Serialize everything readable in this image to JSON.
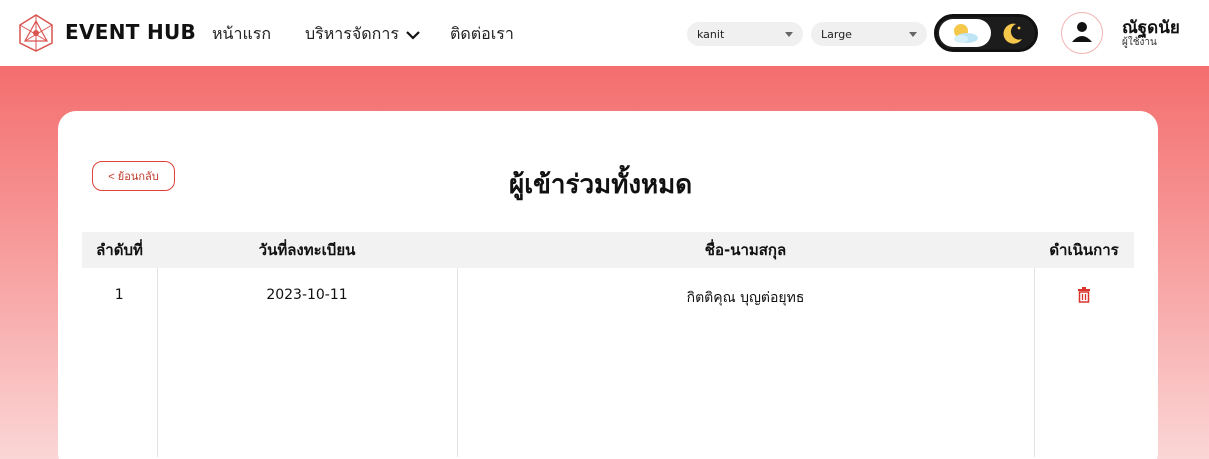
{
  "header": {
    "brand": "EVENT HUB",
    "nav": {
      "home": "หน้าแรก",
      "manage": "บริหารจัดการ",
      "contact": "ติดต่อเรา"
    },
    "font_select": {
      "value": "kanit"
    },
    "size_select": {
      "value": "Large"
    },
    "theme_toggle": {
      "light_icon": "sun-cloud-icon",
      "dark_icon": "moon-icon"
    },
    "user": {
      "name": "ณัฐดนัย",
      "role": "ผู้ใช้งาน"
    }
  },
  "page": {
    "back_label": "< ย้อนกลับ",
    "title": "ผู้เข้าร่วมทั้งหมด"
  },
  "table": {
    "headers": [
      "ลำดับที่",
      "วันที่ลงทะเบียน",
      "ชื่อ-นามสกุล",
      "ดำเนินการ"
    ],
    "rows": [
      {
        "no": "1",
        "date": "2023-10-11",
        "name": "กิตติคุณ บุญต่อยุทธ",
        "action_icon": "trash-icon"
      }
    ]
  },
  "colors": {
    "accent": "#e0413a",
    "hero_top": "#f46e6e",
    "hero_bottom": "#fbd6d6"
  }
}
